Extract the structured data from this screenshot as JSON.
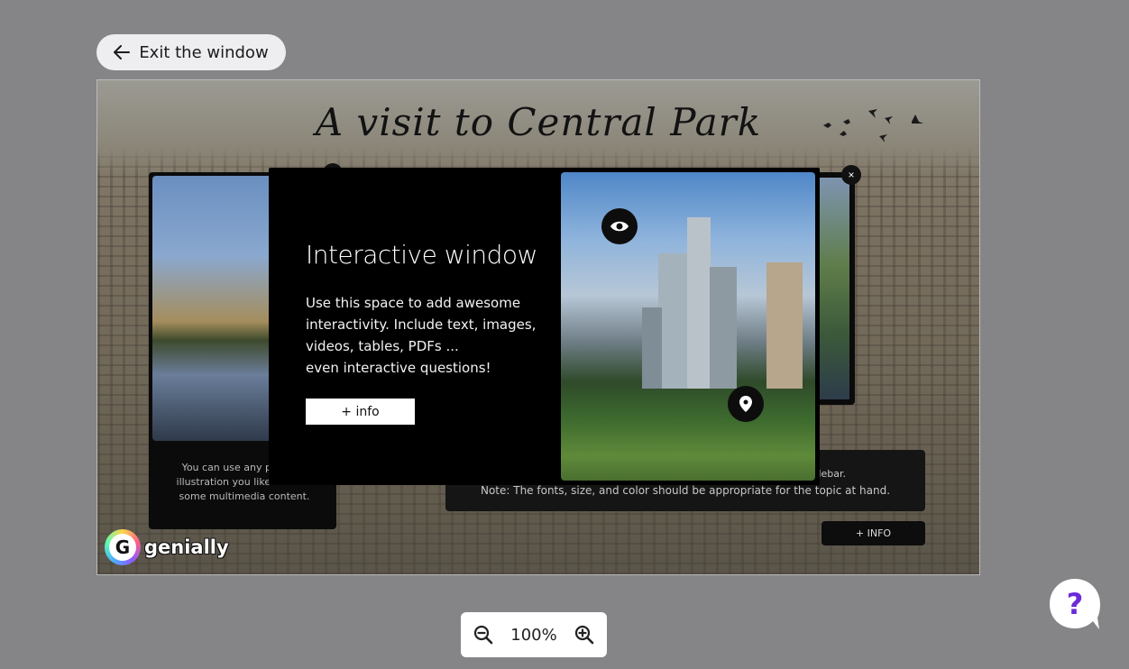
{
  "header": {
    "exit_label": "Exit the window"
  },
  "slide": {
    "title": "A visit to Central Park",
    "left_card_caption": "You can use any photo or illustration you like to mark some multimedia content.",
    "right_card_note_line1": "sidebar.",
    "right_card_note_line2": "Note: The fonts, size, and color should be appropriate for the topic at hand.",
    "right_card_button": "+ INFO",
    "logo_text": "genially"
  },
  "modal": {
    "heading": "Interactive window",
    "body_lines": [
      "Use this space to add awesome",
      "interactivity. Include text, images,",
      "videos, tables, PDFs ...",
      "even interactive questions!"
    ],
    "button_label": "+ info",
    "close_label": "×"
  },
  "zoom": {
    "level": "100%"
  },
  "help": {
    "label": "?"
  },
  "colors": {
    "background": "#858587",
    "modal": "#000000",
    "help_accent": "#6a2bd9"
  },
  "icons": [
    "arrow-left-icon",
    "eye-icon",
    "location-pin-icon",
    "zoom-out-icon",
    "zoom-in-icon",
    "help-icon",
    "close-icon",
    "birds-icon"
  ]
}
